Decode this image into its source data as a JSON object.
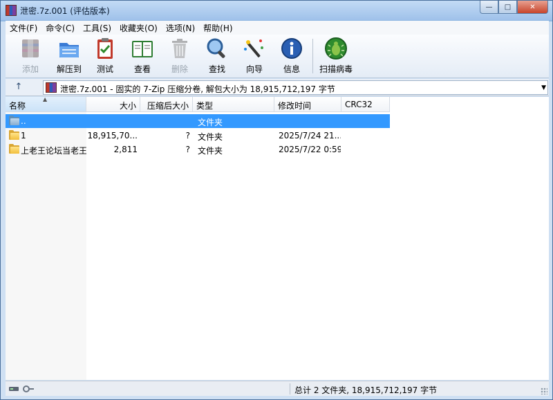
{
  "window": {
    "title": "泄密.7z.001 (评估版本)",
    "controls": {
      "minimize": "—",
      "maximize": "□",
      "close": "✕"
    }
  },
  "menu": [
    "文件(F)",
    "命令(C)",
    "工具(S)",
    "收藏夹(O)",
    "选项(N)",
    "帮助(H)"
  ],
  "toolbar": [
    {
      "label": "添加",
      "icon": "add-archive-icon",
      "disabled": true
    },
    {
      "label": "解压到",
      "icon": "extract-to-icon",
      "disabled": false
    },
    {
      "label": "测试",
      "icon": "test-clipboard-icon",
      "disabled": false
    },
    {
      "label": "查看",
      "icon": "view-book-icon",
      "disabled": false
    },
    {
      "label": "删除",
      "icon": "delete-trash-icon",
      "disabled": true
    },
    {
      "label": "查找",
      "icon": "find-magnifier-icon",
      "disabled": false
    },
    {
      "label": "向导",
      "icon": "wizard-wand-icon",
      "disabled": false
    },
    {
      "label": "信息",
      "icon": "info-icon",
      "disabled": false
    },
    {
      "label": "扫描病毒",
      "icon": "virus-scan-icon",
      "disabled": false
    }
  ],
  "address": {
    "up": "↑",
    "text": "泄密.7z.001 - 固实的 7-Zip 压缩分卷, 解包大小为 18,915,712,197 字节",
    "dropdown": "▼"
  },
  "columns": {
    "name": "名称",
    "size": "大小",
    "packed": "压缩后大小",
    "type": "类型",
    "modified": "修改时间",
    "crc": "CRC32",
    "sort_arrow": "▲"
  },
  "rows": [
    {
      "name": "..",
      "size": "",
      "packed": "",
      "type": "文件夹",
      "modified": "",
      "crc": "",
      "selected": true,
      "parent": true
    },
    {
      "name": "1",
      "size": "18,915,70...",
      "packed": "?",
      "type": "文件夹",
      "modified": "2025/7/24 21...",
      "crc": "",
      "selected": false,
      "parent": false
    },
    {
      "name": "上老王论坛当老王",
      "size": "2,811",
      "packed": "?",
      "type": "文件夹",
      "modified": "2025/7/22 0:59",
      "crc": "",
      "selected": false,
      "parent": false
    }
  ],
  "status": {
    "summary": "总计 2 文件夹, 18,915,712,197 字节"
  },
  "colors": {
    "selection": "#3399ff",
    "folder": "#f2be3b"
  }
}
